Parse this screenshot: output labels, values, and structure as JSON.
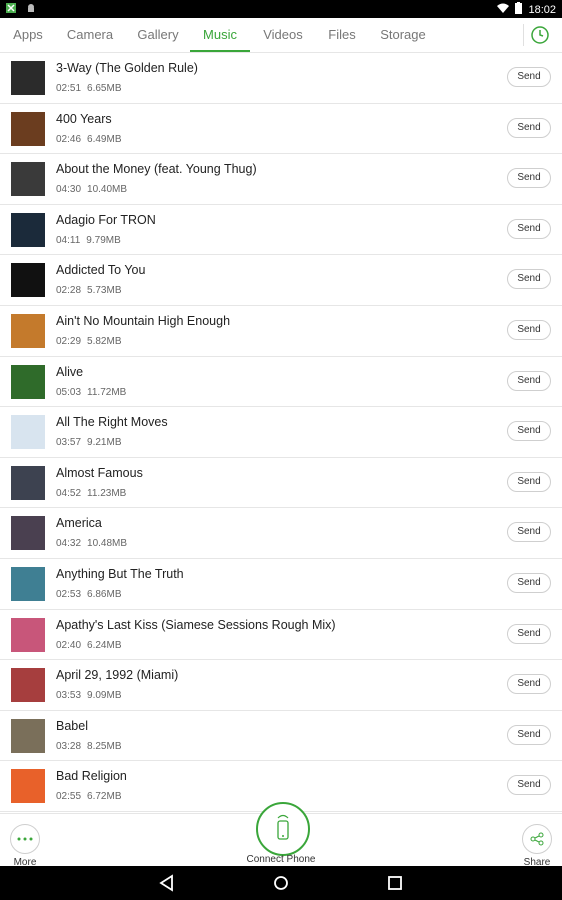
{
  "status_bar": {
    "time": "18:02",
    "left_icons": [
      "app-notification-icon",
      "android-debug-icon"
    ],
    "right_icons": [
      "wifi-icon",
      "battery-icon"
    ]
  },
  "tabs": [
    {
      "label": "Apps",
      "active": false
    },
    {
      "label": "Camera",
      "active": false
    },
    {
      "label": "Gallery",
      "active": false
    },
    {
      "label": "Music",
      "active": true
    },
    {
      "label": "Videos",
      "active": false
    },
    {
      "label": "Files",
      "active": false
    },
    {
      "label": "Storage",
      "active": false
    }
  ],
  "accent_color": "#3aa63a",
  "music": {
    "send_label": "Send",
    "items": [
      {
        "title": "3-Way (The Golden Rule)",
        "duration": "02:51",
        "size": "6.65MB",
        "art_color": "#2b2b2b"
      },
      {
        "title": "400 Years",
        "duration": "02:46",
        "size": "6.49MB",
        "art_color": "#6b3d1f"
      },
      {
        "title": "About the Money (feat. Young Thug)",
        "duration": "04:30",
        "size": "10.40MB",
        "art_color": "#3a3a3a"
      },
      {
        "title": "Adagio For TRON",
        "duration": "04:11",
        "size": "9.79MB",
        "art_color": "#1b2a3a"
      },
      {
        "title": "Addicted To You",
        "duration": "02:28",
        "size": "5.73MB",
        "art_color": "#111111"
      },
      {
        "title": "Ain't No Mountain High Enough",
        "duration": "02:29",
        "size": "5.82MB",
        "art_color": "#c47a2c"
      },
      {
        "title": "Alive",
        "duration": "05:03",
        "size": "11.72MB",
        "art_color": "#2f6b2a"
      },
      {
        "title": "All The Right Moves",
        "duration": "03:57",
        "size": "9.21MB",
        "art_color": "#d8e4ef"
      },
      {
        "title": "Almost Famous",
        "duration": "04:52",
        "size": "11.23MB",
        "art_color": "#3d4250"
      },
      {
        "title": "America",
        "duration": "04:32",
        "size": "10.48MB",
        "art_color": "#4a4050"
      },
      {
        "title": "Anything But The Truth",
        "duration": "02:53",
        "size": "6.86MB",
        "art_color": "#3f7f93"
      },
      {
        "title": "Apathy's Last Kiss (Siamese Sessions Rough Mix)",
        "duration": "02:40",
        "size": "6.24MB",
        "art_color": "#c8567a"
      },
      {
        "title": "April 29, 1992 (Miami)",
        "duration": "03:53",
        "size": "9.09MB",
        "art_color": "#a63e3e"
      },
      {
        "title": "Babel",
        "duration": "03:28",
        "size": "8.25MB",
        "art_color": "#7a6f5a"
      },
      {
        "title": "Bad Religion",
        "duration": "02:55",
        "size": "6.72MB",
        "art_color": "#e8612a"
      }
    ]
  },
  "bottom_bar": {
    "more_label": "More",
    "connect_label": "Connect Phone",
    "share_label": "Share"
  }
}
